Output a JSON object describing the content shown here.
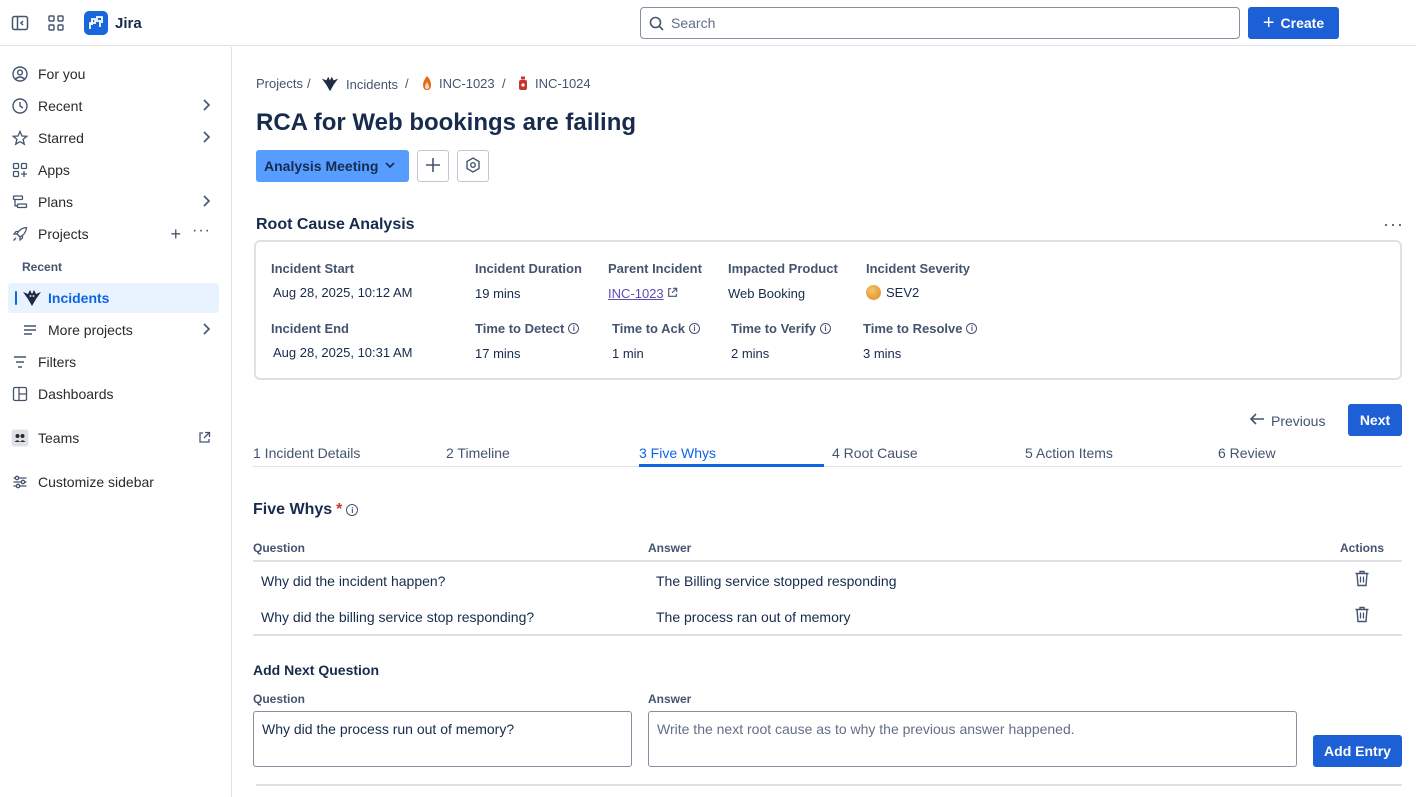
{
  "app": {
    "name": "Jira"
  },
  "search": {
    "placeholder": "Search"
  },
  "create_label": "Create",
  "sidebar": {
    "items": [
      {
        "label": "For you",
        "icon": "user-circle-icon"
      },
      {
        "label": "Recent",
        "icon": "clock-icon"
      },
      {
        "label": "Starred",
        "icon": "star-icon"
      },
      {
        "label": "Apps",
        "icon": "apps-icon"
      },
      {
        "label": "Plans",
        "icon": "plans-icon"
      },
      {
        "label": "Projects",
        "icon": "rocket-icon"
      }
    ],
    "recent_header": "Recent",
    "incidents_label": "Incidents",
    "more_projects_label": "More projects",
    "filters_label": "Filters",
    "dashboards_label": "Dashboards",
    "teams_label": "Teams",
    "customize_label": "Customize sidebar"
  },
  "breadcrumb": {
    "projects": "Projects",
    "incidents": "Incidents",
    "parent": "INC-1023",
    "current": "INC-1024",
    "sep": "/"
  },
  "page_title": "RCA for Web bookings are failing",
  "meeting_label": "Analysis Meeting",
  "rca": {
    "heading": "Root Cause Analysis",
    "incident_start_label": "Incident Start",
    "incident_start": "Aug 28, 2025, 10:12 AM",
    "incident_duration_label": "Incident Duration",
    "incident_duration": "19 mins",
    "parent_incident_label": "Parent Incident",
    "parent_incident": "INC-1023",
    "impacted_product_label": "Impacted Product",
    "impacted_product": "Web Booking",
    "severity_label": "Incident Severity",
    "severity": "SEV2",
    "severity_color": "#e2a03f",
    "incident_end_label": "Incident End",
    "incident_end": "Aug 28, 2025, 10:31 AM",
    "ttd_label": "Time to Detect",
    "ttd": "17 mins",
    "tta_label": "Time to Ack",
    "tta": "1 min",
    "ttv_label": "Time to Verify",
    "ttv": "2 mins",
    "ttr_label": "Time to Resolve",
    "ttr": "3 mins"
  },
  "nav_buttons": {
    "previous": "Previous",
    "next": "Next"
  },
  "tabs": [
    {
      "label": "1 Incident Details"
    },
    {
      "label": "2 Timeline"
    },
    {
      "label": "3 Five Whys"
    },
    {
      "label": "4 Root Cause"
    },
    {
      "label": "5 Action Items"
    },
    {
      "label": "6 Review"
    }
  ],
  "five_whys": {
    "heading": "Five Whys",
    "required_mark": "*",
    "col_question": "Question",
    "col_answer": "Answer",
    "col_actions": "Actions",
    "rows": [
      {
        "question": "Why did the incident happen?",
        "answer": "The Billing service stopped responding"
      },
      {
        "question": "Why did the billing service stop responding?",
        "answer": "The process ran out of memory"
      }
    ]
  },
  "add_next": {
    "heading": "Add Next Question",
    "question_label": "Question",
    "question_value": "Why did the process run out of memory?",
    "answer_label": "Answer",
    "answer_placeholder": "Write the next root cause as to why the previous answer happened.",
    "button": "Add Entry"
  },
  "colors": {
    "accent": "#1d5fd4",
    "link": "#0c66e4",
    "meeting": "#579dff"
  }
}
